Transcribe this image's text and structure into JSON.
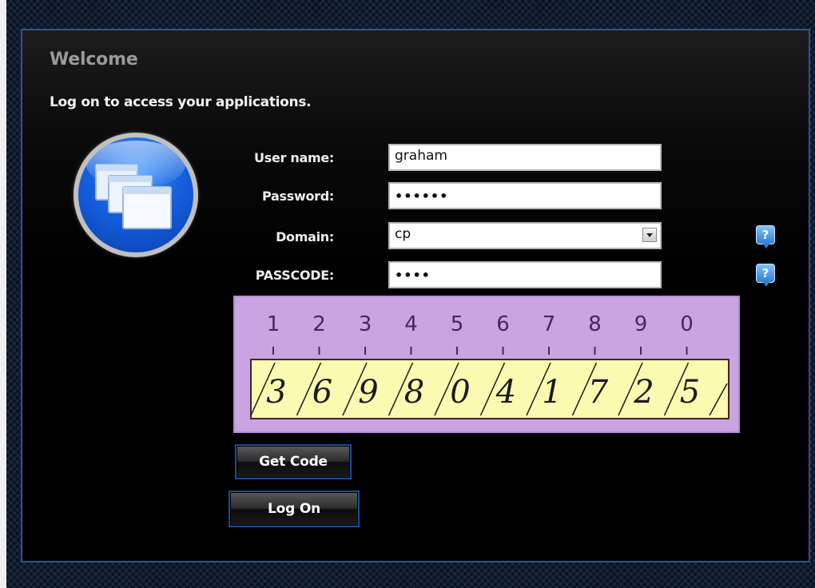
{
  "header": {
    "title": "Welcome",
    "subtitle": "Log on to access your applications."
  },
  "form": {
    "username": {
      "label": "User name:",
      "value": "graham"
    },
    "password": {
      "label": "Password:",
      "value": "••••••"
    },
    "domain": {
      "label": "Domain:",
      "value": "cp"
    },
    "passcode": {
      "label": "PASSCODE:",
      "value": "••••"
    }
  },
  "help": {
    "domain_icon": "?",
    "passcode_icon": "?"
  },
  "grid_card": {
    "positions": [
      "1",
      "2",
      "3",
      "4",
      "5",
      "6",
      "7",
      "8",
      "9",
      "0"
    ],
    "digits": [
      "3",
      "6",
      "9",
      "8",
      "0",
      "4",
      "1",
      "7",
      "2",
      "5"
    ],
    "colors": {
      "card": "#c9a4e0",
      "strip": "#fafab0",
      "ink": "#4a2460"
    }
  },
  "buttons": {
    "get_code": "Get Code",
    "log_on": "Log On"
  },
  "icons": {
    "app_icon": "applications-windows-icon",
    "help_icon": "help-question-icon",
    "select_arrow": "chevron-down-icon"
  },
  "colors": {
    "panel_border": "#23589c",
    "accent": "#1660e0"
  }
}
